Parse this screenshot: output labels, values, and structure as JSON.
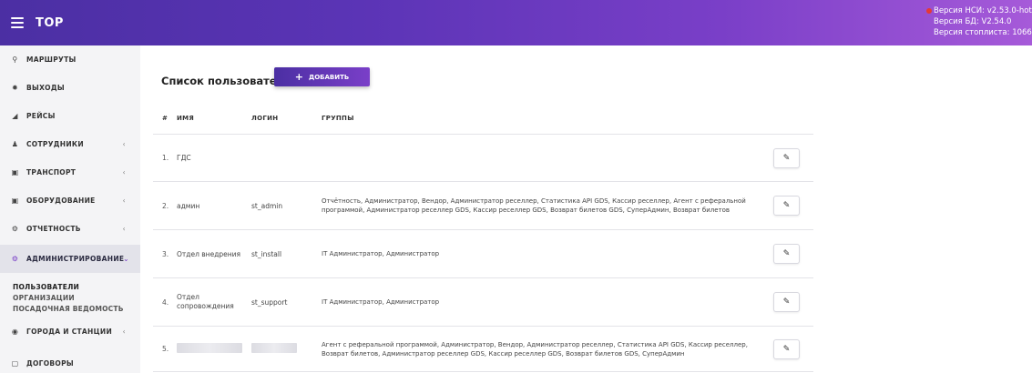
{
  "header": {
    "title": "TOP",
    "versions": [
      "Версия НСИ: v2.53.0-hotfix4",
      "Версия БД: V2.54.0",
      "Версия стоплиста: 1066"
    ]
  },
  "sidebar": {
    "items": [
      {
        "label": "МАРШРУТЫ",
        "icon": "map-pin-icon",
        "glyph": "⚲"
      },
      {
        "label": "ВЫХОДЫ",
        "icon": "gear-icon",
        "glyph": "✹"
      },
      {
        "label": "РЕЙСЫ",
        "icon": "flag-icon",
        "glyph": "◢"
      },
      {
        "label": "СОТРУДНИКИ",
        "icon": "person-icon",
        "glyph": "♟",
        "chevron": "‹"
      },
      {
        "label": "ТРАНСПОРТ",
        "icon": "bus-icon",
        "glyph": "▣",
        "chevron": "‹"
      },
      {
        "label": "ОБОРУДОВАНИЕ",
        "icon": "device-icon",
        "glyph": "▣",
        "chevron": "‹"
      },
      {
        "label": "ОТЧЕТНОСТЬ",
        "icon": "cogs-icon",
        "glyph": "⚙",
        "chevron": "‹"
      },
      {
        "label": "АДМИНИСТРИРОВАНИЕ",
        "icon": "cogs-icon",
        "glyph": "⚙",
        "chevron": "⌄"
      },
      {
        "label": "ГОРОДА И СТАНЦИИ",
        "icon": "location-icon",
        "glyph": "◉",
        "chevron": "‹"
      },
      {
        "label": "ДОГОВОРЫ",
        "icon": "document-icon",
        "glyph": "▢"
      }
    ],
    "subitems": [
      "ПОЛЬЗОВАТЕЛИ",
      "ОРГАНИЗАЦИИ",
      "ПОСАДОЧНАЯ ВЕДОМОСТЬ"
    ]
  },
  "main": {
    "title": "Список пользователей",
    "add_label": "ДОБАВИТЬ",
    "columns": {
      "num": "#",
      "name": "ИМЯ",
      "login": "ЛОГИН",
      "groups": "ГРУППЫ"
    },
    "rows": [
      {
        "num": "1.",
        "name": "ГДС",
        "login": "",
        "groups": ""
      },
      {
        "num": "2.",
        "name": "админ",
        "login": "st_admin",
        "groups": "Отчётность, Администратор, Вендор, Администратор реселлер, Статистика API GDS, Кассир реселлер, Агент с реферальной программой, Администратор реселлер GDS, Кассир реселлер GDS, Возврат билетов GDS, СуперАдмин, Возврат билетов"
      },
      {
        "num": "3.",
        "name": "Отдел внедрения",
        "login": "st_install",
        "groups": "IT Администратор, Администратор"
      },
      {
        "num": "4.",
        "name": "Отдел сопровождения",
        "login": "st_support",
        "groups": "IT Администратор, Администратор"
      },
      {
        "num": "5.",
        "name": "",
        "login": "",
        "groups": "Агент с реферальной программой, Администратор, Вендор, Администратор реселлер, Статистика API GDS, Кассир реселлер, Возврат билетов, Администратор реселлер GDS, Кассир реселлер GDS, Возврат билетов GDS, СуперАдмин"
      }
    ]
  }
}
